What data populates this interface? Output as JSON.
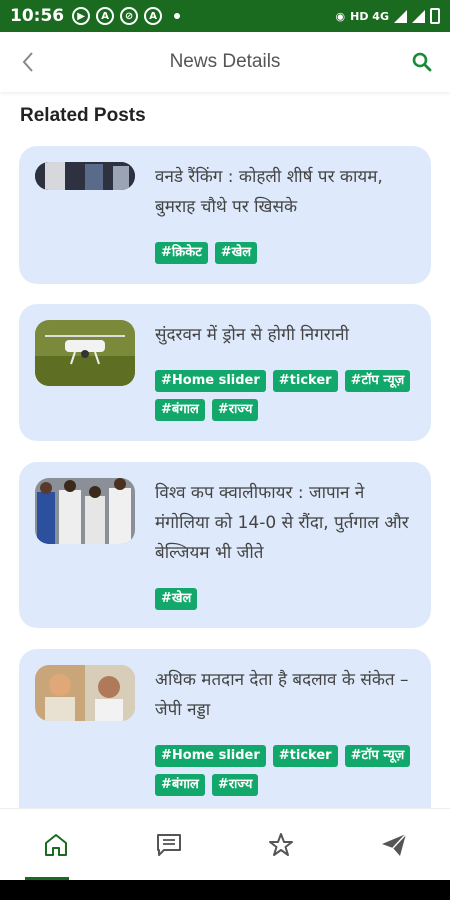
{
  "status_bar": {
    "time": "10:56",
    "network": "HD 4G",
    "colors": {
      "background": "#1a6b1f"
    }
  },
  "app_bar": {
    "title": "News Details",
    "back_icon": "chevron-left-icon",
    "search_icon": "search-icon"
  },
  "section": {
    "title": "Related Posts"
  },
  "posts": [
    {
      "headline": "वनडे रैंकिंग : कोहली शीर्ष पर कायम, बुमराह चौथे पर खिसके",
      "tags": [
        "#क्रिकेट",
        "#खेल"
      ]
    },
    {
      "headline": "सुंदरवन में ड्रोन से होगी निगरानी",
      "tags": [
        "#Home slider",
        "#ticker",
        "#टॉप न्यूज़",
        "#बंगाल",
        "#राज्य"
      ]
    },
    {
      "headline": "विश्व कप क्वालीफायर : जापान ने मंगोलिया को 14-0 से रौंदा, पुर्तगाल और बेल्जियम भी जीते",
      "tags": [
        "#खेल"
      ]
    },
    {
      "headline": "अधिक मतदान देता है बदलाव के संकेत – जेपी नड्डा",
      "tags": [
        "#Home slider",
        "#ticker",
        "#टॉप न्यूज़",
        "#बंगाल",
        "#राज्य"
      ]
    }
  ],
  "bottom_nav": {
    "items": [
      "home-icon",
      "comment-icon",
      "star-icon",
      "send-icon"
    ],
    "active": "home-icon"
  },
  "colors": {
    "accent": "#1a6b1f",
    "card": "#deeafb",
    "tag": "#12a86b"
  }
}
